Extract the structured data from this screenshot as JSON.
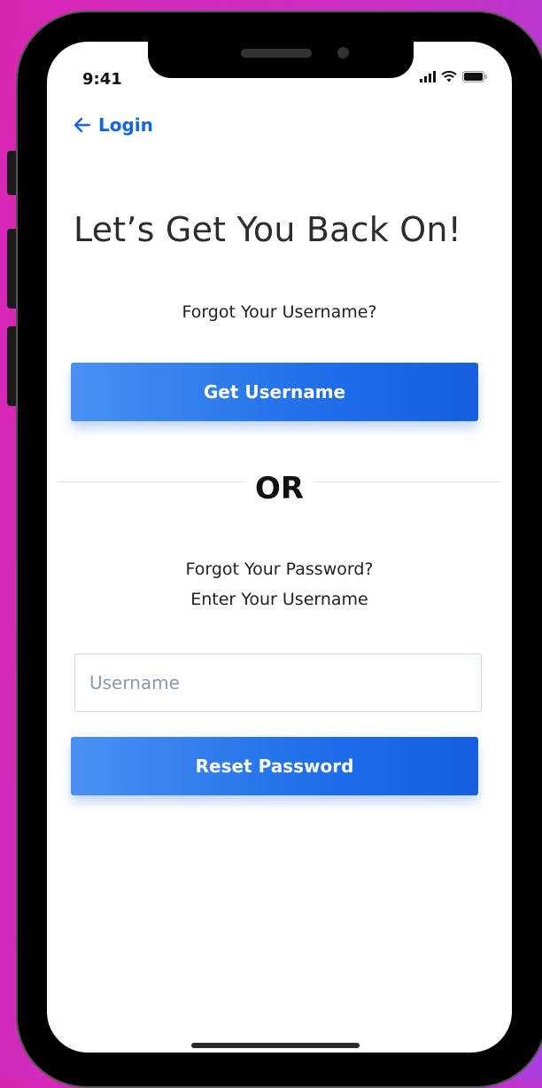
{
  "status_bar": {
    "time": "9:41"
  },
  "nav": {
    "back_label": "Login"
  },
  "main": {
    "title": "Let’s Get You Back On!",
    "username_prompt": "Forgot Your Username?",
    "get_username_label": "Get Username",
    "or_label": "OR",
    "password_prompt_line1": "Forgot Your Password?",
    "password_prompt_line2": "Enter Your Username",
    "username_placeholder": "Username",
    "username_value": "",
    "reset_password_label": "Reset Password"
  },
  "colors": {
    "accent": "#1f6fea",
    "background": "#d826b4",
    "link": "#1565e0"
  },
  "icons": [
    "back-arrow-icon",
    "signal-icon",
    "wifi-icon",
    "battery-icon"
  ]
}
